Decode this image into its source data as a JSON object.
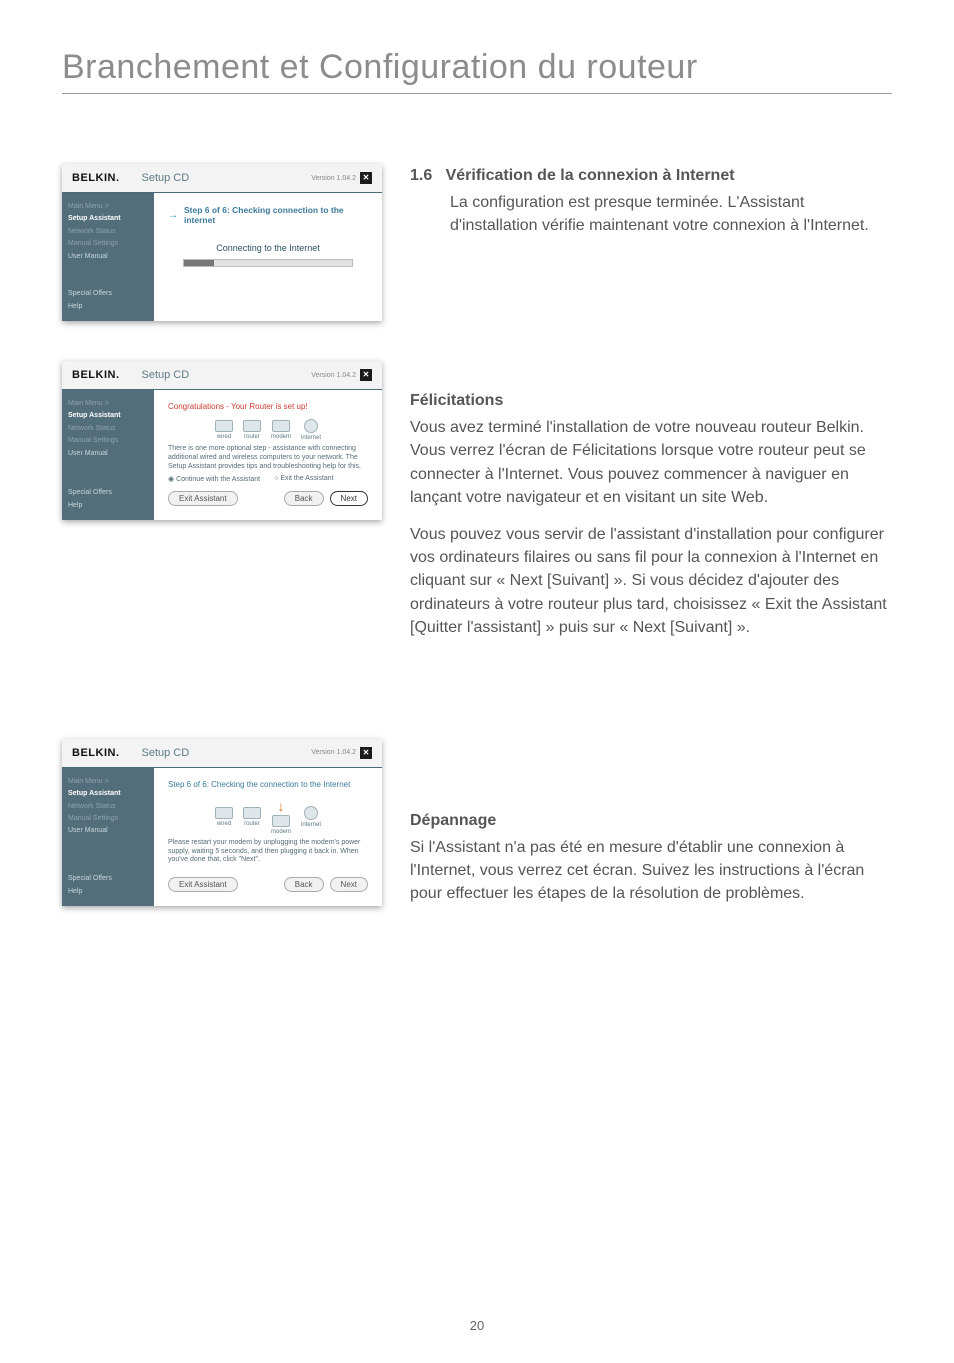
{
  "page_title": "Branchement et Configuration du routeur",
  "page_number": "20",
  "brand": "BELKIN.",
  "setup_cd": "Setup CD",
  "version": "Version 1.04.2",
  "sidebar": {
    "main_menu": "Main Menu  >",
    "setup_assistant": "Setup Assistant",
    "network_status": "Network Status",
    "manual_settings": "Manual Settings",
    "user_manual": "User Manual",
    "special_offers": "Special Offers",
    "help": "Help"
  },
  "card1": {
    "step_line": "Step 6 of 6: Checking connection to the internet",
    "connecting": "Connecting to the Internet"
  },
  "card2": {
    "congrats": "Congratulations - Your Router is set up!",
    "diagram_labels": {
      "wired": "wired",
      "router": "router",
      "modem": "modem",
      "internet": "internet"
    },
    "note": "There is one more optional step - assistance with connecting additional wired and wireless computers to your network. The Setup Assistant provides tips and troubleshooting help for this.",
    "radio_continue": "Continue with the Assistant",
    "radio_exit": "Exit the Assistant",
    "btn_exit": "Exit Assistant",
    "btn_back": "Back",
    "btn_next": "Next"
  },
  "card3": {
    "step_line": "Step 6 of 6: Checking the connection to the Internet",
    "diagram_labels": {
      "wired": "wired",
      "router": "router",
      "modem": "modem",
      "internet": "internet"
    },
    "note": "Please restart your modem by unplugging the modem's power supply, waiting 5 seconds, and then plugging it back in. When you've done that, click \"Next\".",
    "btn_exit": "Exit Assistant",
    "btn_back": "Back",
    "btn_next": "Next"
  },
  "section1": {
    "num": "1.6",
    "title": "Vérification de la connexion à Internet",
    "body": "La configuration est presque terminée. L'Assistant d'installation vérifie maintenant votre connexion à l'Internet."
  },
  "section2": {
    "title": "Félicitations",
    "body1": "Vous avez terminé l'installation de votre nouveau routeur Belkin. Vous verrez l'écran de Félicitations lorsque votre routeur peut se connecter à l'Internet. Vous pouvez commencer à naviguer en lançant votre navigateur et en visitant un site Web.",
    "body2": "Vous pouvez vous servir de l'assistant d'installation pour configurer vos ordinateurs filaires ou sans fil pour la connexion à l'Internet en cliquant sur « Next [Suivant] ». Si vous décidez d'ajouter des ordinateurs à votre routeur plus tard, choisissez « Exit the Assistant [Quitter l'assistant] » puis sur « Next [Suivant] »."
  },
  "section3": {
    "title": "Dépannage",
    "body": "Si l'Assistant n'a pas été en mesure d'établir une connexion à l'Internet, vous verrez cet écran. Suivez les instructions à l'écran pour effectuer les étapes de la résolution de problèmes."
  }
}
